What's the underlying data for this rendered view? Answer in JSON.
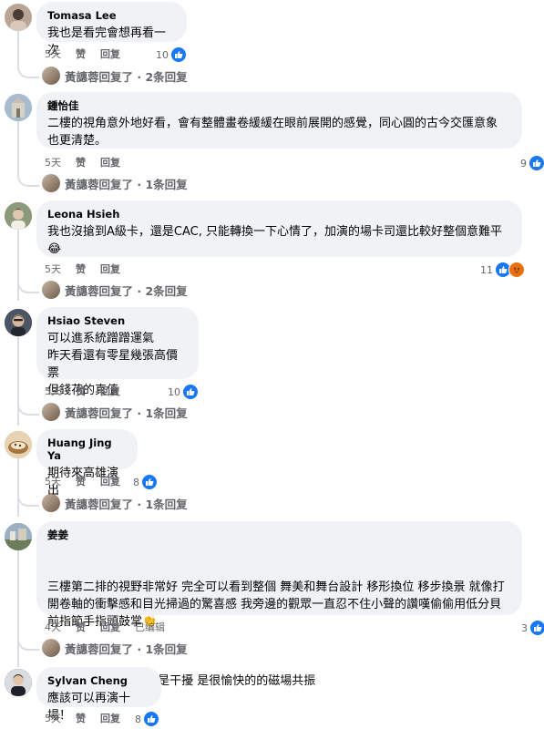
{
  "comments": [
    {
      "author": "Tomasa Lee",
      "paragraphs": [
        "我也是看完會想再看一次"
      ],
      "time": "5天",
      "like": "赞",
      "reply": "回复",
      "reactions": "10",
      "reaction_types": [
        "like"
      ],
      "replies_label": "黃譓蓉回复了 · 2条回复",
      "avatar_color": "#b9a596"
    },
    {
      "author": "鍾怡佳",
      "paragraphs": [
        "二樓的視角意外地好看，會有整體畫卷緩緩在眼前展開的感覺，同心圓的古今交匯意象\n也更清楚。"
      ],
      "time": "5天",
      "like": "赞",
      "reply": "回复",
      "reactions": "9",
      "reaction_types": [
        "like"
      ],
      "replies_label": "黃譓蓉回复了 · 1条回复",
      "avatar_color": "#8fa3b8"
    },
    {
      "author": "Leona Hsieh",
      "paragraphs": [
        "我也沒搶到A級卡，還是CAC, 只能轉換一下心情了，加演的場卡司還比較好整個意難平\n😂"
      ],
      "time": "5天",
      "like": "赞",
      "reply": "回复",
      "reactions": "11",
      "reaction_types": [
        "like",
        "angry"
      ],
      "replies_label": "黃譓蓉回复了 · 2条回复",
      "avatar_color": "#6d7a5e"
    },
    {
      "author": "Hsiao Steven",
      "paragraphs": [
        "可以進系統蹭蹭運氣\n昨天看還有零星幾張高價票\n但錢花的真值"
      ],
      "time": "5天",
      "like": "赞",
      "reply": "回复",
      "reactions": "10",
      "reaction_types": [
        "like"
      ],
      "replies_label": "黃譓蓉回复了 · 1条回复",
      "avatar_color": "#3a3f4a"
    },
    {
      "author": "Huang Jing Ya",
      "paragraphs": [
        "期待來高雄演出"
      ],
      "time": "5天",
      "like": "赞",
      "reply": "回复",
      "reactions": "8",
      "reaction_types": [
        "like"
      ],
      "replies_label": "黃譓蓉回复了 · 1条回复",
      "avatar_color": "#c8a070"
    },
    {
      "author": "姜姜",
      "paragraphs": [
        "三樓第二排的視野非常好 完全可以看到整個 舞美和舞台設計 移形換位 移步換景 就像打\n開卷軸的衝擊感和目光掃過的驚喜感 我旁邊的觀眾一直忍不住小聲的讚嘆偷偷用低分貝\n前指節手指頭鼓掌👏",
        "反而對我來說 反而不是干擾 是很愉快的的磁場共振"
      ],
      "time": "4天",
      "like": "赞",
      "reply": "回复",
      "edited": "已编辑",
      "reactions": "3",
      "reaction_types": [
        "like"
      ],
      "replies_label": "黃譓蓉回复了 · 1条回复",
      "avatar_color": "#7a8a9c"
    },
    {
      "author": "Sylvan Cheng",
      "paragraphs": [
        "應該可以再演十場！"
      ],
      "time": "5天",
      "like": "赞",
      "reply": "回复",
      "reactions": "8",
      "reaction_types": [
        "like"
      ],
      "replies_label": "",
      "avatar_color": "#2f3338"
    }
  ],
  "colors": {
    "bubble": "#f0f2f5",
    "like_blue": "#1877f2",
    "angry_orange": "#e9710f",
    "meta_gray": "#65676b"
  }
}
